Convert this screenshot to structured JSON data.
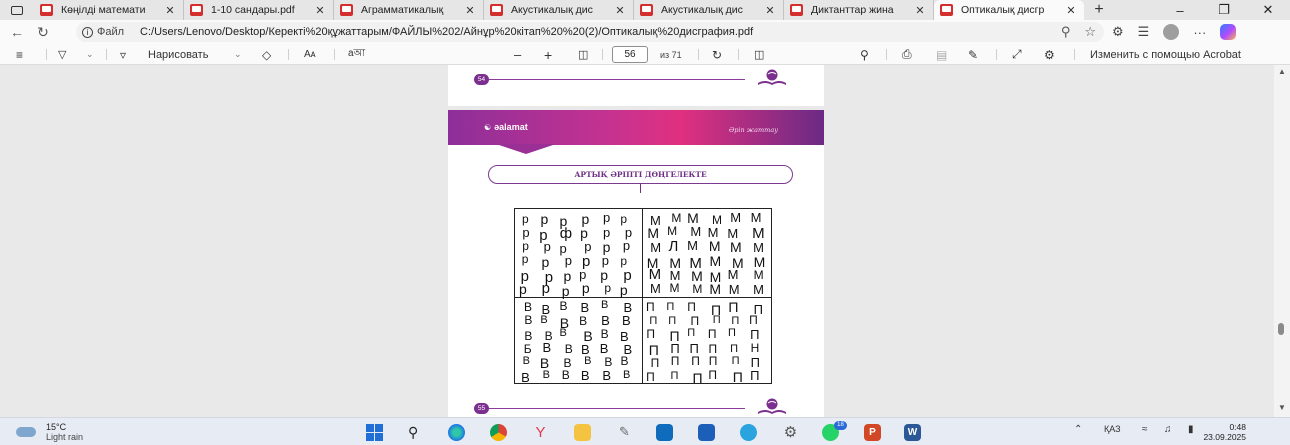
{
  "tabs": [
    {
      "title": "Көңілді математи",
      "active": false
    },
    {
      "title": "1-10 сандары.pdf",
      "active": false
    },
    {
      "title": "Аграмматикалық",
      "active": false
    },
    {
      "title": "Акустикалық дис",
      "active": false
    },
    {
      "title": "Акустикалық дис",
      "active": false
    },
    {
      "title": "Диктанттар жина",
      "active": false
    },
    {
      "title": "Оптикалық дисгр",
      "active": true
    }
  ],
  "address": {
    "scheme_label": "Файл",
    "url": "C:/Users/Lenovo/Desktop/Керекті%20құжаттарым/ФАЙЛЫ%202/Айнұр%20кітап%20%20(2)/Оптикалық%20дисграфия.pdf"
  },
  "pdf_toolbar": {
    "draw_label": "Нарисовать",
    "read_aloud": "Aᴀ",
    "page_current": "56",
    "page_total": "из 71",
    "acrobat_label": "Изменить с помощью Acrobat"
  },
  "page_top": {
    "page_number": "54"
  },
  "page_main": {
    "brand": "ǝalamat",
    "tag": "Әріп жаттау",
    "task_title": "АРТЫҚ ӘРІПТІ ДӨҢГЕЛЕКТЕ",
    "page_number": "55"
  },
  "taskbar": {
    "temp": "15°C",
    "weather": "Light rain",
    "whatsapp_badge": "18",
    "lang": "ҚАЗ",
    "time": "0:48",
    "date": "23.09.2025"
  },
  "colors": {
    "accent_purple": "#7b2f8e",
    "header_pink": "#e0307f",
    "pdf_red": "#d32f2f"
  }
}
